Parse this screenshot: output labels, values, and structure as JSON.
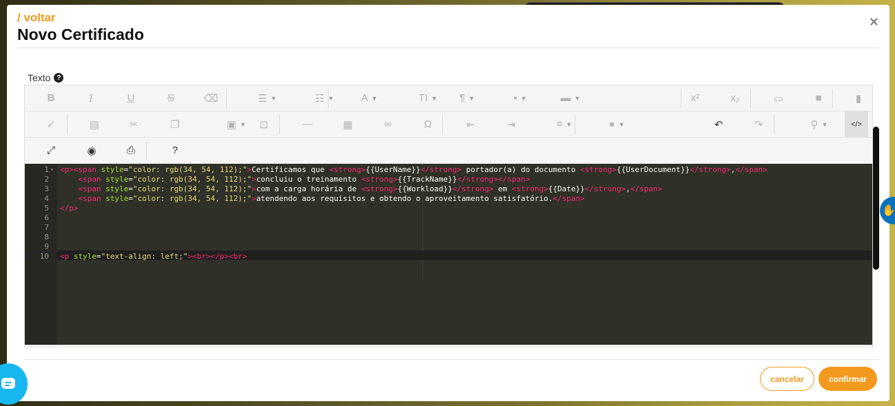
{
  "header": {
    "back_label": "/ voltar",
    "title": "Novo Certificado",
    "close_label": "×"
  },
  "field": {
    "label": "Texto",
    "help_label": "?"
  },
  "toolbar": {
    "row1": [
      {
        "name": "bold-button",
        "icon": "B",
        "caret": false
      },
      {
        "name": "italic-button",
        "icon": "I",
        "caret": false
      },
      {
        "name": "underline-button",
        "icon": "U",
        "caret": false
      },
      {
        "name": "strikethrough-button",
        "icon": "S",
        "caret": false
      },
      {
        "name": "clear-format-button",
        "icon": "⌫",
        "caret": false
      },
      {
        "name": "unordered-list-button",
        "icon": "☰",
        "caret": true
      },
      {
        "name": "ordered-list-button",
        "icon": "☷",
        "caret": true
      },
      {
        "name": "font-color-button",
        "icon": "A",
        "caret": true
      },
      {
        "name": "font-size-button",
        "icon": "TI",
        "caret": true
      },
      {
        "name": "paragraph-format-button",
        "icon": "¶",
        "caret": true
      },
      {
        "name": "paragraph-style-button",
        "icon": "▪",
        "caret": true
      },
      {
        "name": "inline-style-button",
        "icon": "▬",
        "caret": true
      },
      {
        "name": "superscript-button",
        "icon": "x²",
        "caret": false
      },
      {
        "name": "subscript-button",
        "icon": "x₂",
        "caret": false
      },
      {
        "name": "insert-image-button",
        "icon": "▭",
        "caret": false
      },
      {
        "name": "insert-video-button",
        "icon": "■",
        "caret": false
      },
      {
        "name": "insert-file-button",
        "icon": "▮",
        "caret": false
      }
    ],
    "row2": [
      {
        "name": "spellcheck-button",
        "icon": "✓",
        "caret": false
      },
      {
        "name": "format-painter-button",
        "icon": "▤",
        "caret": false
      },
      {
        "name": "cut-button",
        "icon": "✂",
        "caret": false
      },
      {
        "name": "copy-button",
        "icon": "❐",
        "caret": false
      },
      {
        "name": "paste-button",
        "icon": "▣",
        "caret": true
      },
      {
        "name": "select-all-button",
        "icon": "⊡",
        "caret": false
      },
      {
        "name": "horizontal-line-button",
        "icon": "—",
        "caret": false
      },
      {
        "name": "insert-table-button",
        "icon": "▦",
        "caret": false
      },
      {
        "name": "insert-link-button",
        "icon": "∞",
        "caret": false
      },
      {
        "name": "special-characters-button",
        "icon": "Ω",
        "caret": false
      },
      {
        "name": "outdent-button",
        "icon": "⇤",
        "caret": false
      },
      {
        "name": "indent-button",
        "icon": "⇥",
        "caret": false
      },
      {
        "name": "align-button",
        "icon": "≡",
        "caret": true
      },
      {
        "name": "highlight-color-button",
        "icon": "●",
        "caret": true
      },
      {
        "name": "undo-button",
        "icon": "↶",
        "caret": false
      },
      {
        "name": "redo-button",
        "icon": "↷",
        "caret": false
      },
      {
        "name": "find-replace-button",
        "icon": "⚲",
        "caret": true
      },
      {
        "name": "code-view-button",
        "icon": "</>",
        "caret": false
      }
    ],
    "row3": [
      {
        "name": "fullscreen-button",
        "icon": "⤢"
      },
      {
        "name": "preview-button",
        "icon": "◉"
      },
      {
        "name": "print-button",
        "icon": "⎙"
      },
      {
        "name": "help-button",
        "icon": "?"
      }
    ]
  },
  "code_editor": {
    "lines": [
      {
        "n": "1",
        "fold": true,
        "indent": "",
        "text": "<p><span style=\"color: rgb(34, 54, 112);\">Certificamos que <strong>{{UserName}}</strong> portador(a) do documento <strong>{{UserDocument}}</strong>,</span>"
      },
      {
        "n": "2",
        "fold": false,
        "indent": "    ",
        "text": "<span style=\"color: rgb(34, 54, 112);\">concluiu o treinamento <strong>{{TrackName}}</strong></span>"
      },
      {
        "n": "3",
        "fold": false,
        "indent": "    ",
        "text": "<span style=\"color: rgb(34, 54, 112);\">com a carga horária de <strong>{{Workload}}</strong> em <strong>{{Date}}</strong>,</span>"
      },
      {
        "n": "4",
        "fold": false,
        "indent": "    ",
        "text": "<span style=\"color: rgb(34, 54, 112);\">atendendo aos requisitos e obtendo o aproveitamento satisfatório.</span>"
      },
      {
        "n": "5",
        "fold": false,
        "indent": "",
        "text": "</p>"
      },
      {
        "n": "6",
        "fold": false,
        "indent": "",
        "text": ""
      },
      {
        "n": "7",
        "fold": false,
        "indent": "",
        "text": ""
      },
      {
        "n": "8",
        "fold": false,
        "indent": "",
        "text": ""
      },
      {
        "n": "9",
        "fold": false,
        "indent": "",
        "text": ""
      },
      {
        "n": "10",
        "fold": false,
        "indent": "",
        "text": "<p style=\"text-align: left;\"><br></p><br>"
      }
    ]
  },
  "footer": {
    "cancel_label": "cancelar",
    "confirm_label": "confirmar"
  },
  "colors": {
    "accent": "#f39a1e",
    "editor_bg": "#2f3129",
    "tag": "#f92672",
    "attr": "#a6e22e",
    "string": "#e6db74"
  }
}
